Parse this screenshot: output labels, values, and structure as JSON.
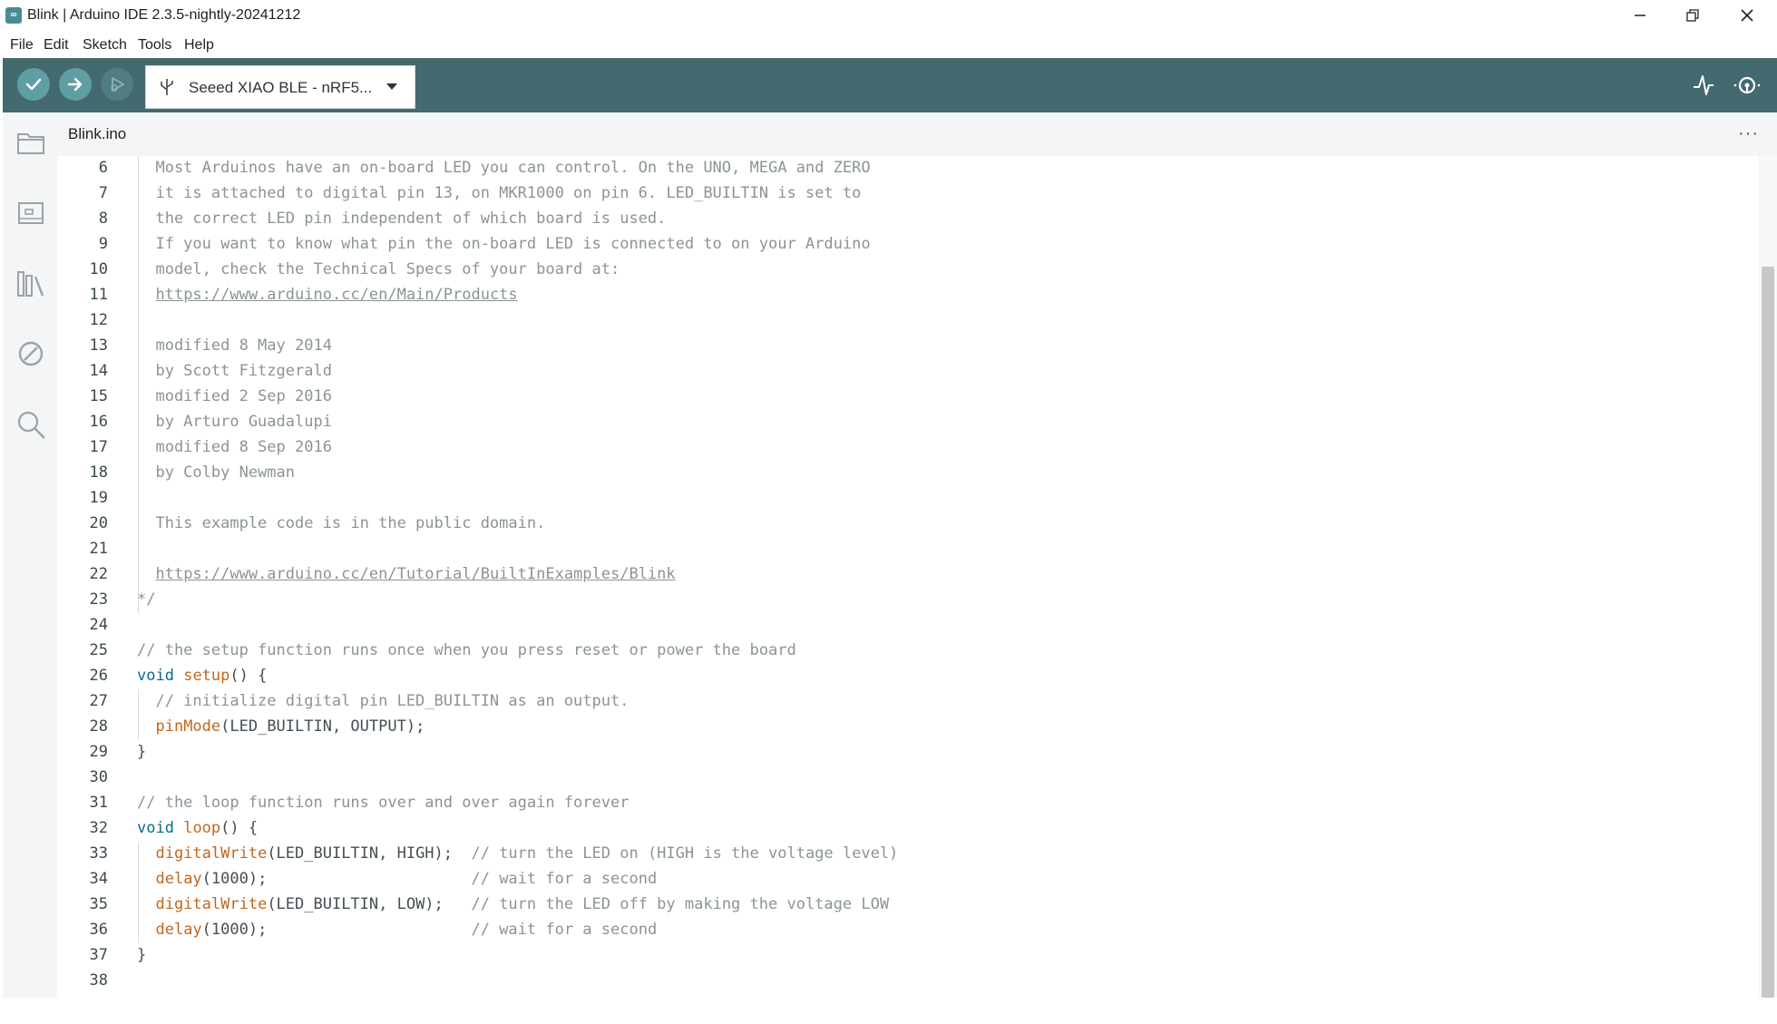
{
  "window": {
    "title": "Blink | Arduino IDE 2.3.5-nightly-20241212",
    "app_icon": "arduino-logo-icon"
  },
  "menu": [
    "File",
    "Edit",
    "Sketch",
    "Tools",
    "Help"
  ],
  "toolbar": {
    "verify_icon": "check-icon",
    "upload_icon": "arrow-right-icon",
    "debug_icon": "debug-icon",
    "board_icon": "usb-icon",
    "board_label": "Seeed XIAO BLE - nRF5...",
    "serial_plotter_icon": "serial-plotter-icon",
    "serial_monitor_icon": "serial-monitor-icon"
  },
  "sidebar": [
    "sketchbook-folder-icon",
    "boards-manager-icon",
    "library-manager-icon",
    "debug-disabled-icon",
    "search-icon"
  ],
  "tab": {
    "label": "Blink.ino",
    "more": "···"
  },
  "colors": {
    "toolbar": "#436a6e",
    "accent": "#008184"
  },
  "editor": {
    "lines": [
      {
        "n": "6",
        "parts": [
          {
            "t": "  Most Arduinos have an on-board LED you can control. On the UNO, MEGA and ZERO",
            "c": "cm"
          }
        ]
      },
      {
        "n": "7",
        "parts": [
          {
            "t": "  it is attached to digital pin 13, on MKR1000 on pin 6. LED_BUILTIN is set to",
            "c": "cm"
          }
        ]
      },
      {
        "n": "8",
        "parts": [
          {
            "t": "  the correct LED pin independent of which board is used.",
            "c": "cm"
          }
        ]
      },
      {
        "n": "9",
        "parts": [
          {
            "t": "  If you want to know what pin the on-board LED is connected to on your Arduino",
            "c": "cm"
          }
        ]
      },
      {
        "n": "10",
        "parts": [
          {
            "t": "  model, check the Technical Specs of your board at:",
            "c": "cm"
          }
        ]
      },
      {
        "n": "11",
        "parts": [
          {
            "t": "  ",
            "c": "cm"
          },
          {
            "t": "https://www.arduino.cc/en/Main/Products",
            "c": "link"
          }
        ]
      },
      {
        "n": "12",
        "parts": []
      },
      {
        "n": "13",
        "parts": [
          {
            "t": "  modified 8 May 2014",
            "c": "cm"
          }
        ]
      },
      {
        "n": "14",
        "parts": [
          {
            "t": "  by Scott Fitzgerald",
            "c": "cm"
          }
        ]
      },
      {
        "n": "15",
        "parts": [
          {
            "t": "  modified 2 Sep 2016",
            "c": "cm"
          }
        ]
      },
      {
        "n": "16",
        "parts": [
          {
            "t": "  by Arturo Guadalupi",
            "c": "cm"
          }
        ]
      },
      {
        "n": "17",
        "parts": [
          {
            "t": "  modified 8 Sep 2016",
            "c": "cm"
          }
        ]
      },
      {
        "n": "18",
        "parts": [
          {
            "t": "  by Colby Newman",
            "c": "cm"
          }
        ]
      },
      {
        "n": "19",
        "parts": []
      },
      {
        "n": "20",
        "parts": [
          {
            "t": "  This example code is in the public domain.",
            "c": "cm"
          }
        ]
      },
      {
        "n": "21",
        "parts": []
      },
      {
        "n": "22",
        "parts": [
          {
            "t": "  ",
            "c": "cm"
          },
          {
            "t": "https://www.arduino.cc/en/Tutorial/BuiltInExamples/Blink",
            "c": "link"
          }
        ]
      },
      {
        "n": "23",
        "parts": [
          {
            "t": "*/",
            "c": "cm"
          }
        ]
      },
      {
        "n": "24",
        "parts": []
      },
      {
        "n": "25",
        "parts": [
          {
            "t": "// the setup function runs once when you press reset or power the board",
            "c": "cm"
          }
        ]
      },
      {
        "n": "26",
        "parts": [
          {
            "t": "void",
            "c": "kw"
          },
          {
            "t": " ",
            "c": "pl"
          },
          {
            "t": "setup",
            "c": "fn"
          },
          {
            "t": "() {",
            "c": "pl"
          }
        ]
      },
      {
        "n": "27",
        "parts": [
          {
            "t": "  // initialize digital pin LED_BUILTIN as an output.",
            "c": "cm"
          }
        ]
      },
      {
        "n": "28",
        "parts": [
          {
            "t": "  ",
            "c": "pl"
          },
          {
            "t": "pinMode",
            "c": "fn"
          },
          {
            "t": "(LED_BUILTIN, OUTPUT);",
            "c": "pl"
          }
        ]
      },
      {
        "n": "29",
        "parts": [
          {
            "t": "}",
            "c": "pl"
          }
        ]
      },
      {
        "n": "30",
        "parts": []
      },
      {
        "n": "31",
        "parts": [
          {
            "t": "// the loop function runs over and over again forever",
            "c": "cm"
          }
        ]
      },
      {
        "n": "32",
        "parts": [
          {
            "t": "void",
            "c": "kw"
          },
          {
            "t": " ",
            "c": "pl"
          },
          {
            "t": "loop",
            "c": "fn"
          },
          {
            "t": "() {",
            "c": "pl"
          }
        ]
      },
      {
        "n": "33",
        "parts": [
          {
            "t": "  ",
            "c": "pl"
          },
          {
            "t": "digitalWrite",
            "c": "fn"
          },
          {
            "t": "(LED_BUILTIN, HIGH);  ",
            "c": "pl"
          },
          {
            "t": "// turn the LED on (HIGH is the voltage level)",
            "c": "cm"
          }
        ]
      },
      {
        "n": "34",
        "parts": [
          {
            "t": "  ",
            "c": "pl"
          },
          {
            "t": "delay",
            "c": "fn"
          },
          {
            "t": "(1000);                      ",
            "c": "pl"
          },
          {
            "t": "// wait for a second",
            "c": "cm"
          }
        ]
      },
      {
        "n": "35",
        "parts": [
          {
            "t": "  ",
            "c": "pl"
          },
          {
            "t": "digitalWrite",
            "c": "fn"
          },
          {
            "t": "(LED_BUILTIN, LOW);   ",
            "c": "pl"
          },
          {
            "t": "// turn the LED off by making the voltage LOW",
            "c": "cm"
          }
        ]
      },
      {
        "n": "36",
        "parts": [
          {
            "t": "  ",
            "c": "pl"
          },
          {
            "t": "delay",
            "c": "fn"
          },
          {
            "t": "(1000);                      ",
            "c": "pl"
          },
          {
            "t": "// wait for a second",
            "c": "cm"
          }
        ]
      },
      {
        "n": "37",
        "parts": [
          {
            "t": "}",
            "c": "pl"
          }
        ]
      },
      {
        "n": "38",
        "parts": []
      }
    ]
  }
}
